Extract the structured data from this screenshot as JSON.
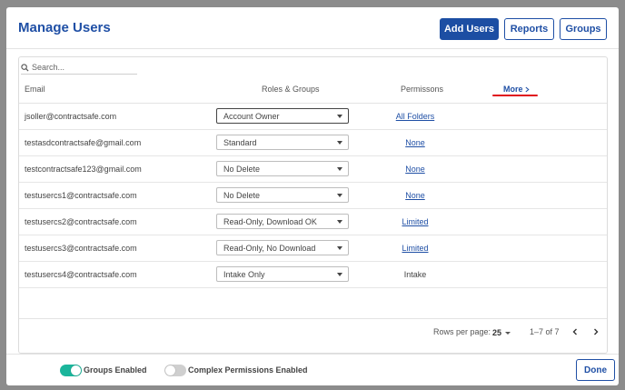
{
  "header": {
    "title": "Manage Users",
    "add_users_label": "Add Users",
    "reports_label": "Reports",
    "groups_label": "Groups"
  },
  "search": {
    "placeholder": "Search..."
  },
  "table": {
    "columns": {
      "email": "Email",
      "roles": "Roles & Groups",
      "permissions": "Permissons",
      "more": "More"
    },
    "rows": [
      {
        "email": "jsoller@contractsafe.com",
        "role": "Account Owner",
        "permission": "All Folders",
        "permission_link": true
      },
      {
        "email": "testasdcontractsafe@gmail.com",
        "role": "Standard",
        "permission": "None",
        "permission_link": true
      },
      {
        "email": "testcontractsafe123@gmail.com",
        "role": "No Delete",
        "permission": "None",
        "permission_link": true
      },
      {
        "email": "testusercs1@contractsafe.com",
        "role": "No Delete",
        "permission": "None",
        "permission_link": true
      },
      {
        "email": "testusercs2@contractsafe.com",
        "role": "Read-Only, Download OK",
        "permission": "Limited",
        "permission_link": true
      },
      {
        "email": "testusercs3@contractsafe.com",
        "role": "Read-Only, No Download",
        "permission": "Limited",
        "permission_link": true
      },
      {
        "email": "testusercs4@contractsafe.com",
        "role": "Intake Only",
        "permission": "Intake",
        "permission_link": false
      }
    ]
  },
  "pagination": {
    "rows_per_page_label": "Rows per page:",
    "rows_per_page": "25",
    "range": "1–7 of 7",
    "prev_icon": "chevron-left-icon",
    "next_icon": "chevron-right-icon"
  },
  "footer": {
    "groups_enabled_label": "Groups Enabled",
    "groups_enabled": true,
    "complex_permissions_label": "Complex Permissions Enabled",
    "complex_permissions": false,
    "done_label": "Done"
  },
  "colors": {
    "brand": "#1f4fa5",
    "primary_button": "#1c4ea3",
    "toggle_on": "#1bb59b",
    "more_underline": "#e0101d"
  }
}
